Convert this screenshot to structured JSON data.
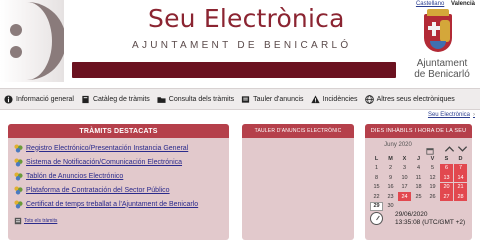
{
  "header": {
    "title": "Seu Electrònica",
    "subtitle": "AJUNTAMENT DE BENICARLÓ",
    "languages": [
      {
        "label": "Castellano",
        "active": false
      },
      {
        "label": "Valencià",
        "active": true
      }
    ],
    "logo_text_line1": "Ajuntament",
    "logo_text_line2": "de Benicarló"
  },
  "nav": {
    "items": [
      {
        "label": "Informació general",
        "icon": "info-icon"
      },
      {
        "label": "Catàleg de tràmits",
        "icon": "book-icon"
      },
      {
        "label": "Consulta dels tràmits",
        "icon": "folder-icon"
      },
      {
        "label": "Tauler d'anuncis",
        "icon": "noticeboard-icon"
      },
      {
        "label": "Incidències",
        "icon": "warning-icon"
      },
      {
        "label": "Altres seus electròniques",
        "icon": "globe-icon"
      }
    ]
  },
  "breadcrumb": "Seu Electrònica",
  "tramits": {
    "heading": "TRÀMITS DESTACATS",
    "items": [
      "Registro Electrónico/Presentación Instancia General",
      "Sistema de Notificación/Comunicación Electrónica",
      "Tablón de Anuncios Electrónico",
      "Plataforma de Contratación del Sector Público",
      "Certificat de temps treballat a l'Ajuntament de Benicarlo"
    ],
    "all_link": "Tots els tràmits"
  },
  "tauler": {
    "heading": "TAULER D'ANUNCIS ELECTRÒNIC"
  },
  "calendar": {
    "heading": "DIES INHÀBILS I HORA DE LA SEU",
    "month": "Juny 2020",
    "weekdays": [
      "L",
      "M",
      "X",
      "J",
      "V",
      "S",
      "D"
    ],
    "days": [
      "1",
      "2",
      "3",
      "4",
      "5",
      "6",
      "7",
      "8",
      "9",
      "10",
      "11",
      "12",
      "13",
      "14",
      "15",
      "16",
      "17",
      "18",
      "19",
      "20",
      "21",
      "22",
      "23",
      "24",
      "25",
      "26",
      "27",
      "28",
      "29",
      "30"
    ],
    "holidays": [
      "6",
      "7",
      "13",
      "14",
      "20",
      "21",
      "24",
      "27",
      "28"
    ],
    "today": "29",
    "date": "29/06/2020",
    "time": "13:35:08 (UTC/GMT +2)",
    "colors": {
      "holiday": "#e2484f",
      "panel": "#e2c9cc",
      "header": "#b5404b"
    }
  },
  "colors": {
    "brand": "#8b2431",
    "title_bar": "#6b1220"
  }
}
